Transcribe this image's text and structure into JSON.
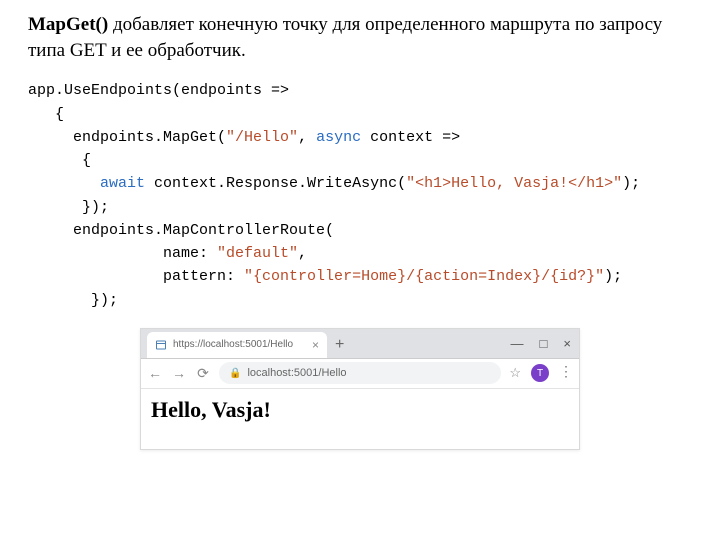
{
  "description": {
    "bold": "MapGet()",
    "text": " добавляет конечную точку для определенного маршрута по запросу типа GET и ее обработчик."
  },
  "code": {
    "l1": "app.UseEndpoints(endpoints =>",
    "l2": "   {",
    "l3a": "     endpoints.MapGet(",
    "l3b": "\"/Hello\"",
    "l3c": ", ",
    "l3d": "async",
    "l3e": " context =>",
    "l4": "      {",
    "l5a": "        ",
    "l5b": "await",
    "l5c": " context.Response.WriteAsync(",
    "l5d": "\"<h1>Hello, Vasja!</h1>\"",
    "l5e": ");",
    "l6": "      });",
    "l7": "     endpoints.MapControllerRoute(",
    "l8a": "               name: ",
    "l8b": "\"default\"",
    "l8c": ",",
    "l9a": "               pattern: ",
    "l9b": "\"{controller=Home}/{action=Index}/{id?}\"",
    "l9c": ");",
    "l10": "       });"
  },
  "browser": {
    "tab_title": "https://localhost:5001/Hello",
    "url": "localhost:5001/Hello",
    "newtab": "+",
    "minimize": "—",
    "maximize": "□",
    "close": "×",
    "back": "←",
    "forward": "→",
    "reload": "⟳",
    "star": "☆",
    "avatar": "T",
    "dots": "⋮",
    "tab_close": "×",
    "page_h1": "Hello, Vasja!"
  }
}
